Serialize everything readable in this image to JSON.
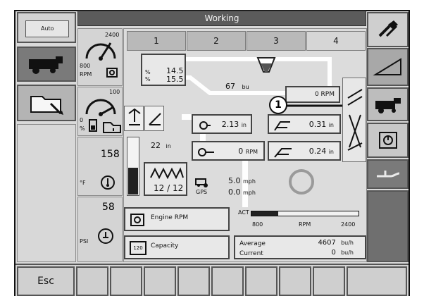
{
  "header": {
    "title": "Working"
  },
  "tabs": [
    {
      "label": "1"
    },
    {
      "label": "2"
    },
    {
      "label": "3"
    },
    {
      "label": "4"
    }
  ],
  "left": {
    "auto_badge": "Auto",
    "rpm_gauge": {
      "top": "2400",
      "bottom": "800",
      "unit": "RPM"
    },
    "fuel_gauge": {
      "top": "100",
      "bottom": "0",
      "unit": "%"
    },
    "temp": {
      "value": "158",
      "unit": "°F"
    },
    "pressure": {
      "value": "58",
      "unit": "PSI"
    }
  },
  "map": {
    "pct_top": "14.5",
    "pct_bottom": "15.5",
    "pct_unit": "%",
    "bushels": "67",
    "bushels_unit": "bu"
  },
  "readouts": {
    "r1": {
      "value": "2.13",
      "unit": "in"
    },
    "r2": {
      "value": "0.31",
      "unit": "in"
    },
    "r3": {
      "value": "0",
      "unit": "RPM"
    },
    "r4": {
      "value": "0.24",
      "unit": "in"
    },
    "rpm_top": {
      "value": "0",
      "unit": "RPM"
    },
    "height": {
      "value": "22",
      "unit": "in"
    },
    "counter": "12 / 12",
    "speed1": {
      "value": "5.0",
      "unit": "mph"
    },
    "speed2": {
      "value": "0.0",
      "unit": "mph"
    },
    "gps": "GPS"
  },
  "callout": {
    "num": "1"
  },
  "bottom": {
    "engine_label": "Engine RPM",
    "capacity_label": "Capacity",
    "capacity_icon_text": "120",
    "act": "ACT",
    "scale": {
      "min": "800",
      "unit": "RPM",
      "max": "2400"
    },
    "avg_label": "Average",
    "avg_value": "4607",
    "avg_unit": "bu/h",
    "cur_label": "Current",
    "cur_value": "0",
    "cur_unit": "bu/h",
    "engine_rpm_fraction": 0.25
  },
  "footer": {
    "esc": "Esc"
  }
}
